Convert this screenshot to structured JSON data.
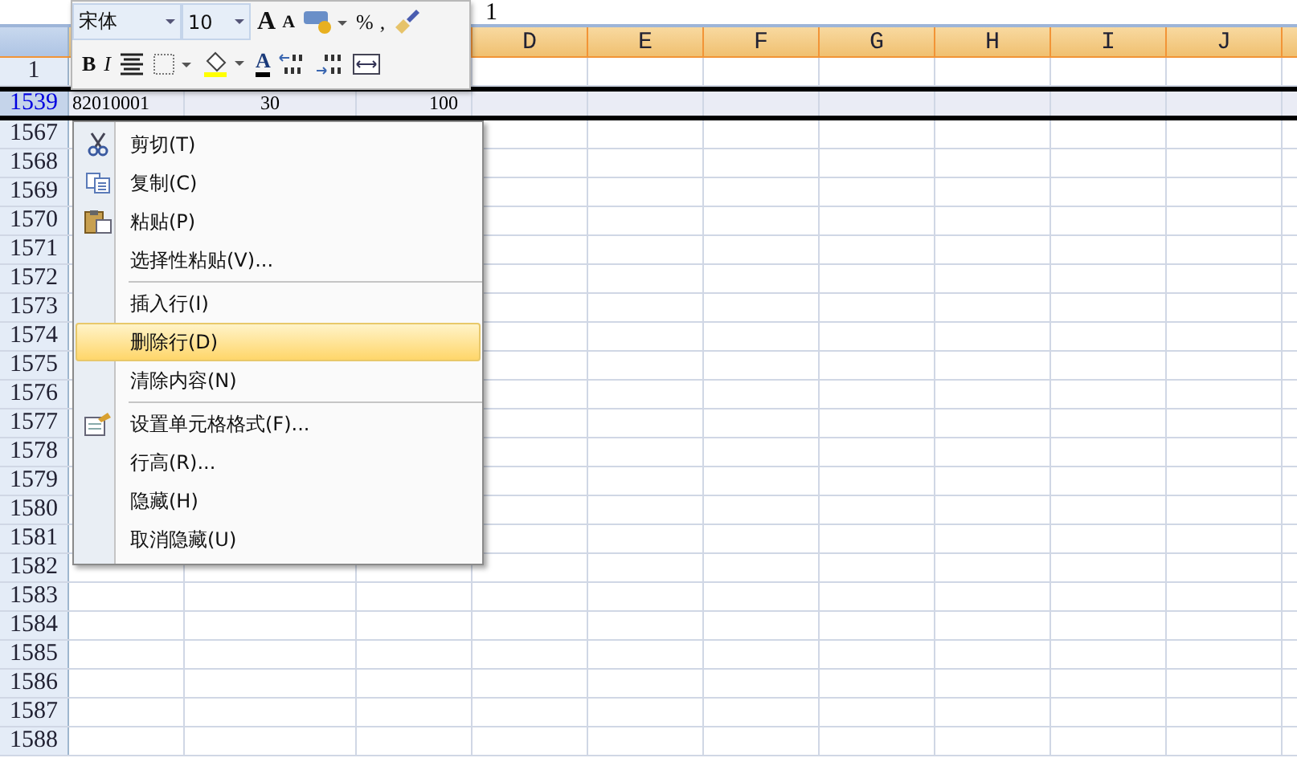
{
  "formula_bar": {
    "value": "1"
  },
  "mini_toolbar": {
    "font": "宋体",
    "size": "10",
    "row_1": [
      {
        "kind": "grow",
        "label": "A"
      },
      {
        "kind": "shrink",
        "label": "A"
      },
      {
        "kind": "currency"
      },
      {
        "kind": "percent",
        "label": "%"
      },
      {
        "kind": "comma",
        "label": ","
      },
      {
        "kind": "painter"
      }
    ],
    "row_2": [
      {
        "kind": "bold",
        "label": "B"
      },
      {
        "kind": "italic",
        "label": "I"
      },
      {
        "kind": "align"
      },
      {
        "kind": "borders"
      },
      {
        "kind": "fill"
      },
      {
        "kind": "fontcolor",
        "label": "A"
      },
      {
        "kind": "decinc"
      },
      {
        "kind": "decdec"
      },
      {
        "kind": "merge"
      }
    ]
  },
  "columns": [
    "D",
    "E",
    "F",
    "G",
    "H",
    "I",
    "J"
  ],
  "rows": [
    {
      "header": "1",
      "selected": false,
      "cells": []
    },
    {
      "header": "1539",
      "selected": true,
      "cells": [
        "82010001",
        "30",
        "100"
      ]
    },
    {
      "header": "1567",
      "selected": false,
      "cells": []
    },
    {
      "header": "1568",
      "selected": false,
      "cells": []
    },
    {
      "header": "1569",
      "selected": false,
      "cells": []
    },
    {
      "header": "1570",
      "selected": false,
      "cells": []
    },
    {
      "header": "1571",
      "selected": false,
      "cells": []
    },
    {
      "header": "1572",
      "selected": false,
      "cells": []
    },
    {
      "header": "1573",
      "selected": false,
      "cells": []
    },
    {
      "header": "1574",
      "selected": false,
      "cells": []
    },
    {
      "header": "1575",
      "selected": false,
      "cells": []
    },
    {
      "header": "1576",
      "selected": false,
      "cells": []
    },
    {
      "header": "1577",
      "selected": false,
      "cells": []
    },
    {
      "header": "1578",
      "selected": false,
      "cells": []
    },
    {
      "header": "1579",
      "selected": false,
      "cells": []
    },
    {
      "header": "1580",
      "selected": false,
      "cells": []
    },
    {
      "header": "1581",
      "selected": false,
      "cells": []
    },
    {
      "header": "1582",
      "selected": false,
      "cells": []
    },
    {
      "header": "1583",
      "selected": false,
      "cells": []
    },
    {
      "header": "1584",
      "selected": false,
      "cells": []
    },
    {
      "header": "1585",
      "selected": false,
      "cells": []
    },
    {
      "header": "1586",
      "selected": false,
      "cells": []
    },
    {
      "header": "1587",
      "selected": false,
      "cells": []
    },
    {
      "header": "1588",
      "selected": false,
      "cells": []
    }
  ],
  "context_menu": [
    {
      "kind": "cut",
      "label": "剪切(T)",
      "selected": false
    },
    {
      "kind": "copy",
      "label": "复制(C)",
      "selected": false
    },
    {
      "kind": "paste",
      "label": "粘贴(P)",
      "selected": false
    },
    {
      "kind": "item",
      "label": "选择性粘贴(V)...",
      "selected": false
    },
    {
      "kind": "separator"
    },
    {
      "kind": "item",
      "label": "插入行(I)",
      "selected": false
    },
    {
      "kind": "item",
      "label": "删除行(D)",
      "selected": true
    },
    {
      "kind": "item",
      "label": "清除内容(N)",
      "selected": false
    },
    {
      "kind": "separator"
    },
    {
      "kind": "format",
      "label": "设置单元格格式(F)...",
      "selected": false
    },
    {
      "kind": "item",
      "label": "行高(R)...",
      "selected": false
    },
    {
      "kind": "item",
      "label": "隐藏(H)",
      "selected": false
    },
    {
      "kind": "item",
      "label": "取消隐藏(U)",
      "selected": false
    }
  ]
}
